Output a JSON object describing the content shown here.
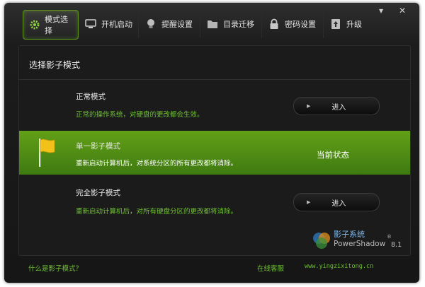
{
  "tabs": [
    {
      "label": "模式选择",
      "icon": "gear-icon"
    },
    {
      "label": "开机启动",
      "icon": "monitor-icon"
    },
    {
      "label": "提醒设置",
      "icon": "lightbulb-icon"
    },
    {
      "label": "目录迁移",
      "icon": "folder-icon"
    },
    {
      "label": "密码设置",
      "icon": "lock-icon"
    },
    {
      "label": "升级",
      "icon": "upgrade-icon"
    }
  ],
  "window_controls": {
    "minimize": "▾",
    "close": "✕"
  },
  "panel": {
    "title": "选择影子模式"
  },
  "modes": [
    {
      "title": "正常模式",
      "desc": "正常的操作系统，对硬盘的更改都会生效。",
      "button": "进入"
    },
    {
      "title": "单一影子模式",
      "desc": "重新启动计算机后，对系统分区的所有更改都将消除。",
      "status": "当前状态",
      "icon": "flag-icon"
    },
    {
      "title": "完全影子模式",
      "desc": "重新启动计算机后，对所有硬盘分区的更改都将消除。",
      "button": "进入"
    }
  ],
  "logo": {
    "name": "影子系统",
    "product": "PowerShadow",
    "version": "8.1",
    "reg": "®"
  },
  "footer": {
    "help": "什么是影子模式？",
    "support": "在线客服",
    "site": "www.yingzixitong.cn"
  },
  "colors": {
    "accent": "#6fc033",
    "active_bg": "#5a9a16",
    "window_bg": "#1b1b1b"
  }
}
